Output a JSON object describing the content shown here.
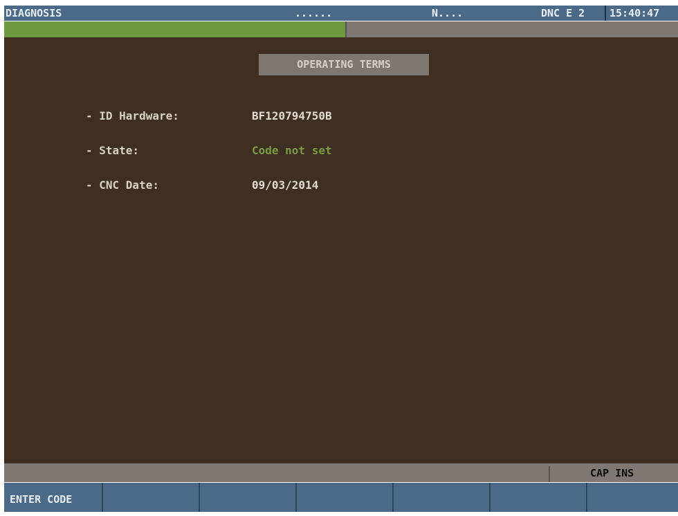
{
  "header": {
    "mode": "DIAGNOSIS",
    "dots": "......",
    "program": "N....",
    "dnc_status": "DNC E 2",
    "time": "15:40:47"
  },
  "progress": {
    "fraction": 0.506,
    "fill_color": "#6f9a3f"
  },
  "main": {
    "title": "OPERATING TERMS",
    "rows": [
      {
        "label": "- ID Hardware:",
        "value": "BF120794750B",
        "value_color": "#e4dbd0"
      },
      {
        "label": "- State:",
        "value": "Code not set",
        "value_color": "#7a9a44"
      },
      {
        "label": "- CNC Date:",
        "value": "09/03/2014",
        "value_color": "#e4dbd0"
      }
    ]
  },
  "status": {
    "keyboard_mode": "CAP INS"
  },
  "softkeys": [
    {
      "label": "ENTER CODE"
    },
    {
      "label": ""
    },
    {
      "label": ""
    },
    {
      "label": ""
    },
    {
      "label": ""
    },
    {
      "label": ""
    },
    {
      "label": ""
    }
  ],
  "colors": {
    "header_bg": "#4a6a87",
    "panel_bg": "#3f2f22",
    "bar_gray": "#7f7873"
  }
}
